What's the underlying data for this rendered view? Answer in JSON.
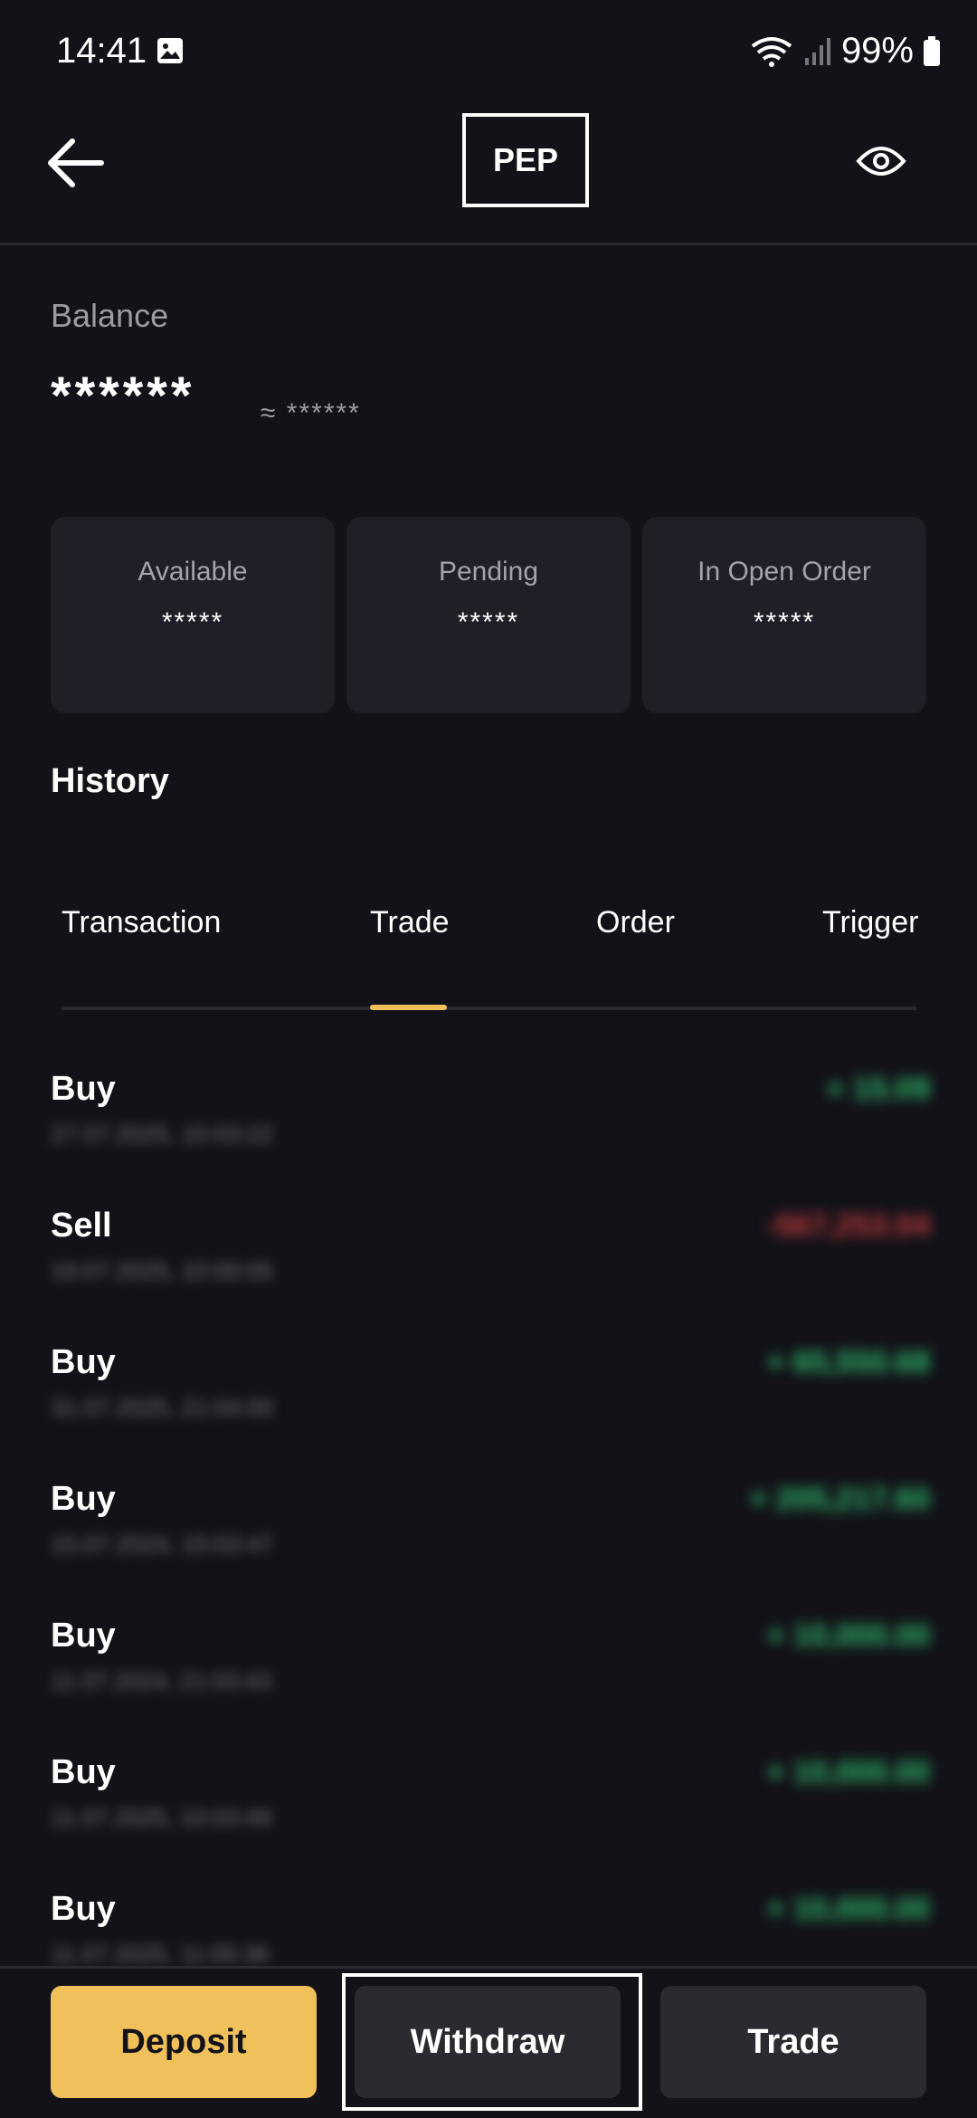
{
  "status_bar": {
    "time": "14:41",
    "battery": "99%",
    "icons": [
      "image-icon",
      "wifi-icon",
      "signal-icon",
      "battery-icon"
    ]
  },
  "header": {
    "title": "PEP",
    "back_icon": "arrow-left-icon",
    "visibility_icon": "eye-icon"
  },
  "balance": {
    "label": "Balance",
    "value": "******",
    "approx": "≈ ******"
  },
  "cards": [
    {
      "label": "Available",
      "value": "*****"
    },
    {
      "label": "Pending",
      "value": "*****"
    },
    {
      "label": "In Open Order",
      "value": "*****"
    }
  ],
  "history": {
    "title": "History",
    "tabs": [
      {
        "label": "Transaction",
        "active": false
      },
      {
        "label": "Trade",
        "active": true
      },
      {
        "label": "Order",
        "active": false
      },
      {
        "label": "Trigger",
        "active": false
      }
    ],
    "rows": [
      {
        "type": "Buy",
        "date": "27.07.2025, 10:03:22",
        "amount": "+ 15.09",
        "sign": "pos"
      },
      {
        "type": "Sell",
        "date": "19.07.2025, 10:00:05",
        "amount": "-567,253.04",
        "sign": "neg"
      },
      {
        "type": "Buy",
        "date": "31.07.2025, 21:04:00",
        "amount": "+ 65,550.68",
        "sign": "pos"
      },
      {
        "type": "Buy",
        "date": "15.07.2024, 15:03:47",
        "amount": "+ 205,217.60",
        "sign": "pos"
      },
      {
        "type": "Buy",
        "date": "11.07.2024, 21:03:43",
        "amount": "+ 10,000.00",
        "sign": "pos"
      },
      {
        "type": "Buy",
        "date": "11.07.2025, 10:03:49",
        "amount": "+ 10,000.00",
        "sign": "pos"
      },
      {
        "type": "Buy",
        "date": "11.07.2025, 11:05:36",
        "amount": "+ 10,000.00",
        "sign": "pos"
      }
    ]
  },
  "actions": {
    "deposit": "Deposit",
    "withdraw": "Withdraw",
    "trade": "Trade"
  },
  "colors": {
    "background": "#131219",
    "accent": "#f0c05a",
    "positive": "#2ebd6b",
    "negative": "#c23b3b",
    "card": "#1f1f27"
  }
}
